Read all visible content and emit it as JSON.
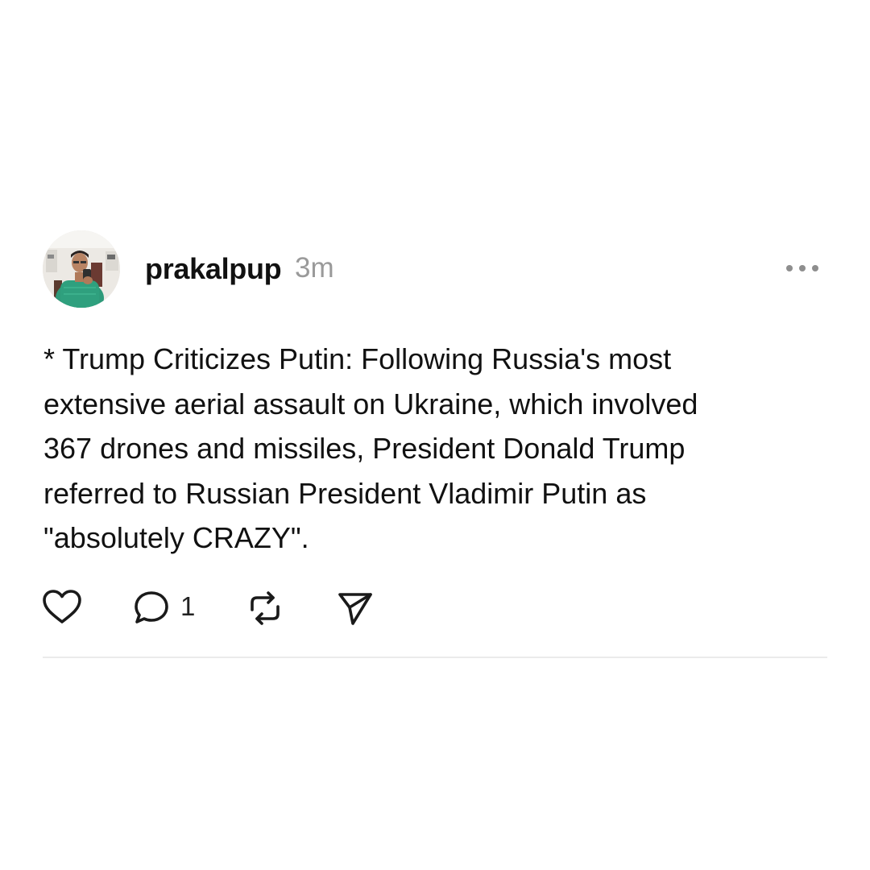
{
  "post": {
    "author": {
      "username": "prakalpup",
      "avatar_icon": "profile-photo-avatar"
    },
    "timestamp": "3m",
    "text": "* Trump Criticizes Putin: Following Russia's most\nextensive aerial assault on Ukraine, which involved\n367 drones and missiles, President Donald Trump\nreferred to Russian President Vladimir Putin as\n\"absolutely CRAZY\".",
    "actions": {
      "like_icon": "heart-icon",
      "reply_icon": "speech-bubble-icon",
      "reply_count": "1",
      "repost_icon": "repost-icon",
      "share_icon": "send-icon"
    },
    "more_icon": "more-horizontal-icon"
  },
  "colors": {
    "background": "#ffffff",
    "text": "#111111",
    "muted": "#9a9a9a",
    "divider": "#ebebeb"
  }
}
